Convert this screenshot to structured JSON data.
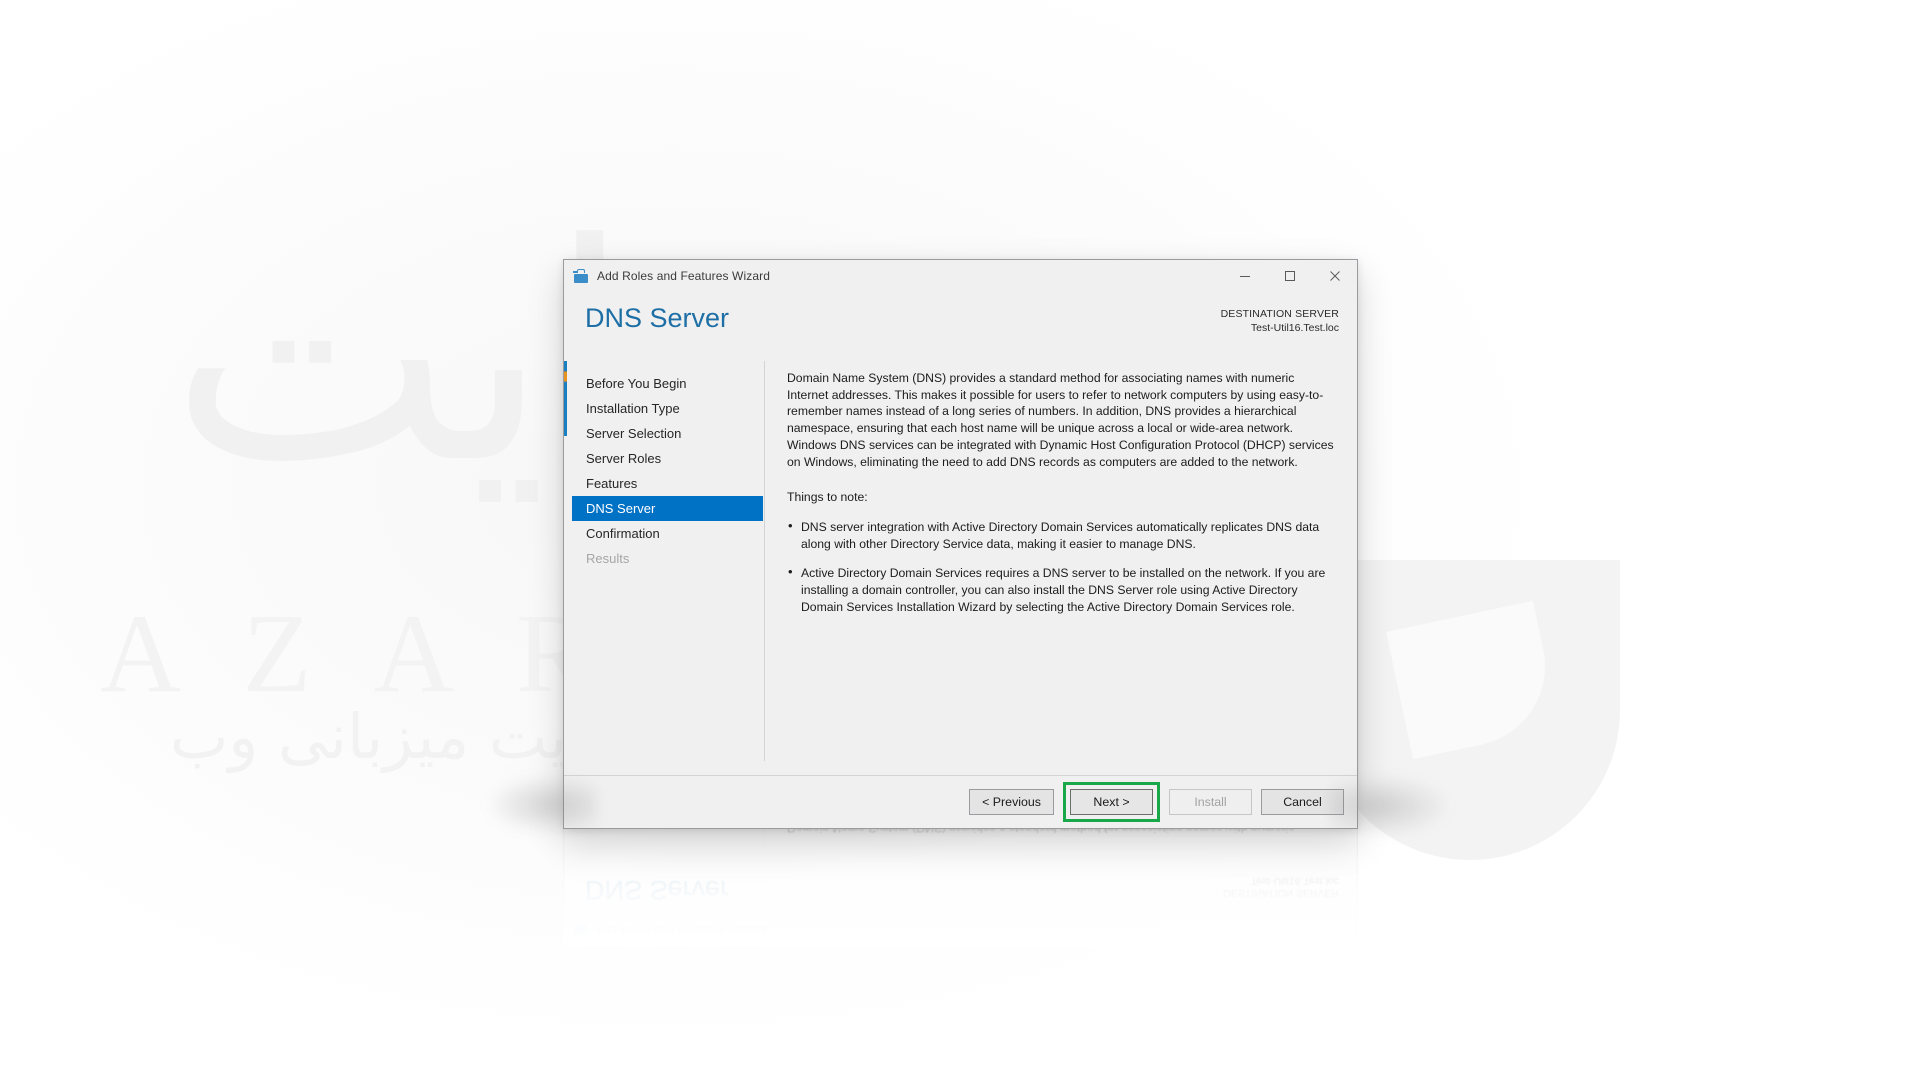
{
  "window": {
    "title": "Add Roles and Features Wizard",
    "icon": "wizard-toolbox-icon",
    "controls": {
      "minimize": "–",
      "maximize": "□",
      "close": "✕"
    }
  },
  "header": {
    "page_title": "DNS Server",
    "destination_label": "DESTINATION SERVER",
    "destination_value": "Test-Util16.Test.loc"
  },
  "nav": {
    "items": [
      {
        "label": "Before You Begin",
        "state": "normal"
      },
      {
        "label": "Installation Type",
        "state": "normal"
      },
      {
        "label": "Server Selection",
        "state": "normal"
      },
      {
        "label": "Server Roles",
        "state": "normal"
      },
      {
        "label": "Features",
        "state": "normal"
      },
      {
        "label": "DNS Server",
        "state": "active"
      },
      {
        "label": "Confirmation",
        "state": "normal"
      },
      {
        "label": "Results",
        "state": "disabled"
      }
    ]
  },
  "content": {
    "intro_paragraph": "Domain Name System (DNS) provides a standard method for associating names with numeric Internet addresses. This makes it possible for users to refer to network computers by using easy-to-remember names instead of a long series of numbers. In addition, DNS provides a hierarchical namespace, ensuring that each host name will be unique across a local or wide-area network. Windows DNS services can be integrated with Dynamic Host Configuration Protocol (DHCP) services on Windows, eliminating the need to add DNS records as computers are added to the network.",
    "notes_heading": "Things to note:",
    "notes": [
      "DNS server integration with Active Directory Domain Services automatically replicates DNS data along with other Directory Service data, making it easier to manage DNS.",
      "Active Directory Domain Services requires a DNS server to be installed on the network. If you are installing a domain controller, you can also install the DNS Server role using Active Directory Domain Services Installation Wizard by selecting the Active Directory Domain Services role."
    ]
  },
  "footer": {
    "previous_label": "< Previous",
    "next_label": "Next >",
    "install_label": "Install",
    "cancel_label": "Cancel",
    "install_disabled": true,
    "highlight_color": "#18a749",
    "highlighted_button": "Next >"
  },
  "watermark": {
    "arabic_top": "سایت",
    "latin": "AZARSYS",
    "persian": "سرعت بی نهایت میزبانی وب"
  },
  "theme": {
    "accent_blue": "#0072c6",
    "title_blue": "#1d6fa5",
    "window_bg": "#f0f0f0",
    "border": "#999b9e"
  }
}
